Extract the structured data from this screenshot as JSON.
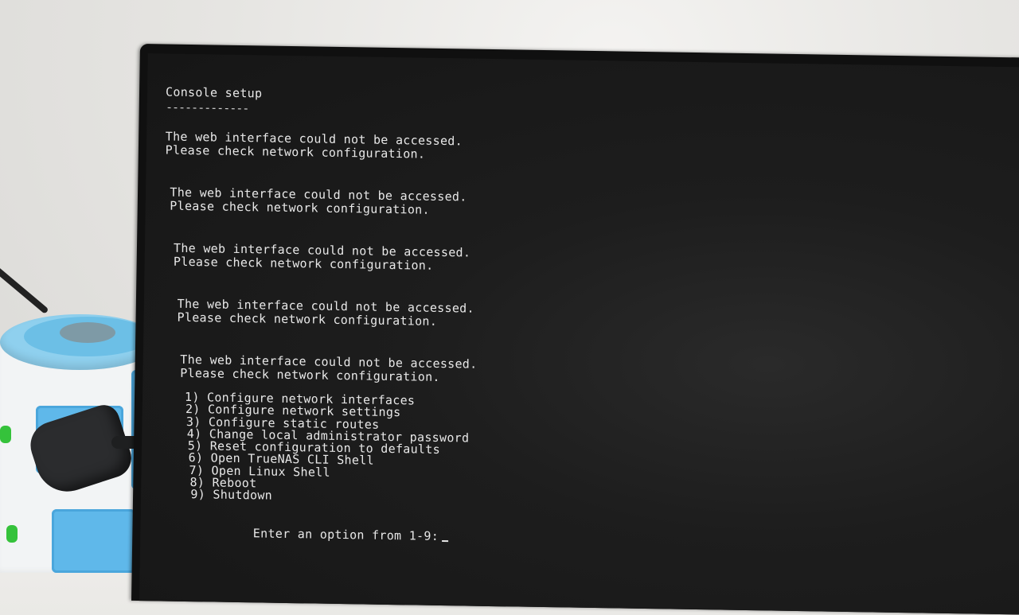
{
  "console": {
    "title": "Console setup",
    "title_underline": "-------------",
    "warnings": [
      {
        "line1": "The web interface could not be accessed.",
        "line2": "Please check network configuration."
      },
      {
        "line1": "The web interface could not be accessed.",
        "line2": "Please check network configuration."
      },
      {
        "line1": "The web interface could not be accessed.",
        "line2": "Please check network configuration."
      },
      {
        "line1": "The web interface could not be accessed.",
        "line2": "Please check network configuration."
      },
      {
        "line1": "The web interface could not be accessed.",
        "line2": "Please check network configuration."
      }
    ],
    "menu": [
      "1) Configure network interfaces",
      "2) Configure network settings",
      "3) Configure static routes",
      "4) Change local administrator password",
      "5) Reset configuration to defaults",
      "6) Open TrueNAS CLI Shell",
      "7) Open Linux Shell",
      "8) Reboot",
      "9) Shutdown"
    ],
    "prompt": "Enter an option from 1-9:"
  }
}
